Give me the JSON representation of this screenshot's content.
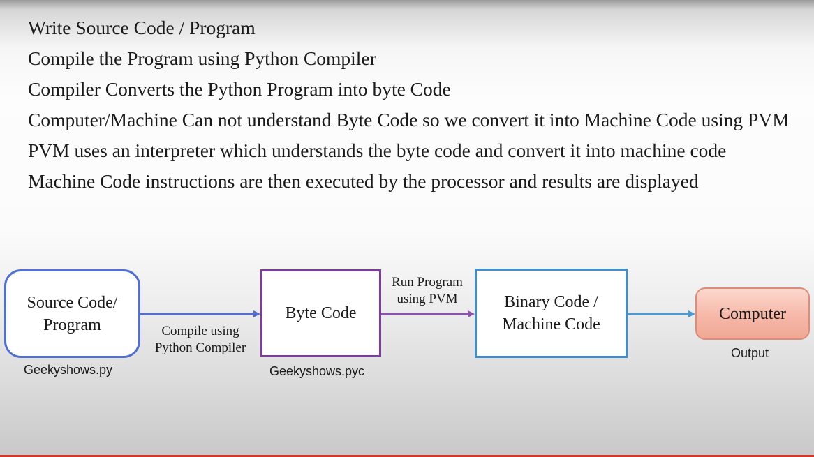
{
  "bullets": [
    "Write Source Code / Program",
    "Compile the Program using Python Compiler",
    "Compiler Converts the Python Program into byte Code",
    "Computer/Machine Can not understand Byte Code so we convert it into Machine Code using PVM",
    "PVM uses an interpreter which understands the byte code and convert it into machine code",
    "Machine Code instructions are then executed by the processor and results are displayed"
  ],
  "diagram": {
    "source_box": {
      "line1": "Source Code/",
      "line2": "Program",
      "file": "Geekyshows.py"
    },
    "compile_arrow": {
      "line1": "Compile using",
      "line2": "Python Compiler"
    },
    "byte_box": {
      "label": "Byte Code",
      "file": "Geekyshows.pyc"
    },
    "run_arrow": {
      "line1": "Run Program",
      "line2": "using PVM"
    },
    "binary_box": {
      "line1": "Binary Code /",
      "line2": "Machine Code"
    },
    "computer_box": {
      "label": "Computer",
      "caption": "Output"
    },
    "colors": {
      "source_border": "#4f6fd6",
      "byte_border": "#7b3c9c",
      "binary_border": "#3f8ecf",
      "computer_fill": "#f6b8a8",
      "arrow_blue": "#4f6fd6",
      "arrow_purple": "#8e4fb0",
      "arrow_lightblue": "#4a9ad6"
    }
  }
}
